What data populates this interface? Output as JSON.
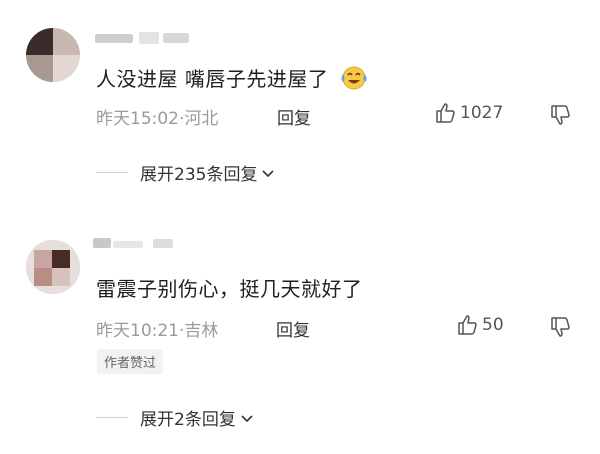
{
  "comments": [
    {
      "text": "人没进屋 嘴唇子先进屋了",
      "emoji": "laughing-crying-emoji",
      "time": "昨天15:02·河北",
      "reply_label": "回复",
      "likes": "1027",
      "expand_label": "展开235条回复"
    },
    {
      "text": "雷震子别伤心，挺几天就好了",
      "time": "昨天10:21·吉林",
      "reply_label": "回复",
      "likes": "50",
      "badge": "作者赞过",
      "expand_label": "展开2条回复"
    }
  ],
  "colors": {
    "meta": "#9a9a9a",
    "badge_bg": "#f2f2f2",
    "emoji_yellow": "#f7c948",
    "emoji_tear": "#5aa7e6"
  },
  "icons": [
    "thumbs-up-icon",
    "thumbs-down-icon",
    "chevron-down-icon"
  ]
}
